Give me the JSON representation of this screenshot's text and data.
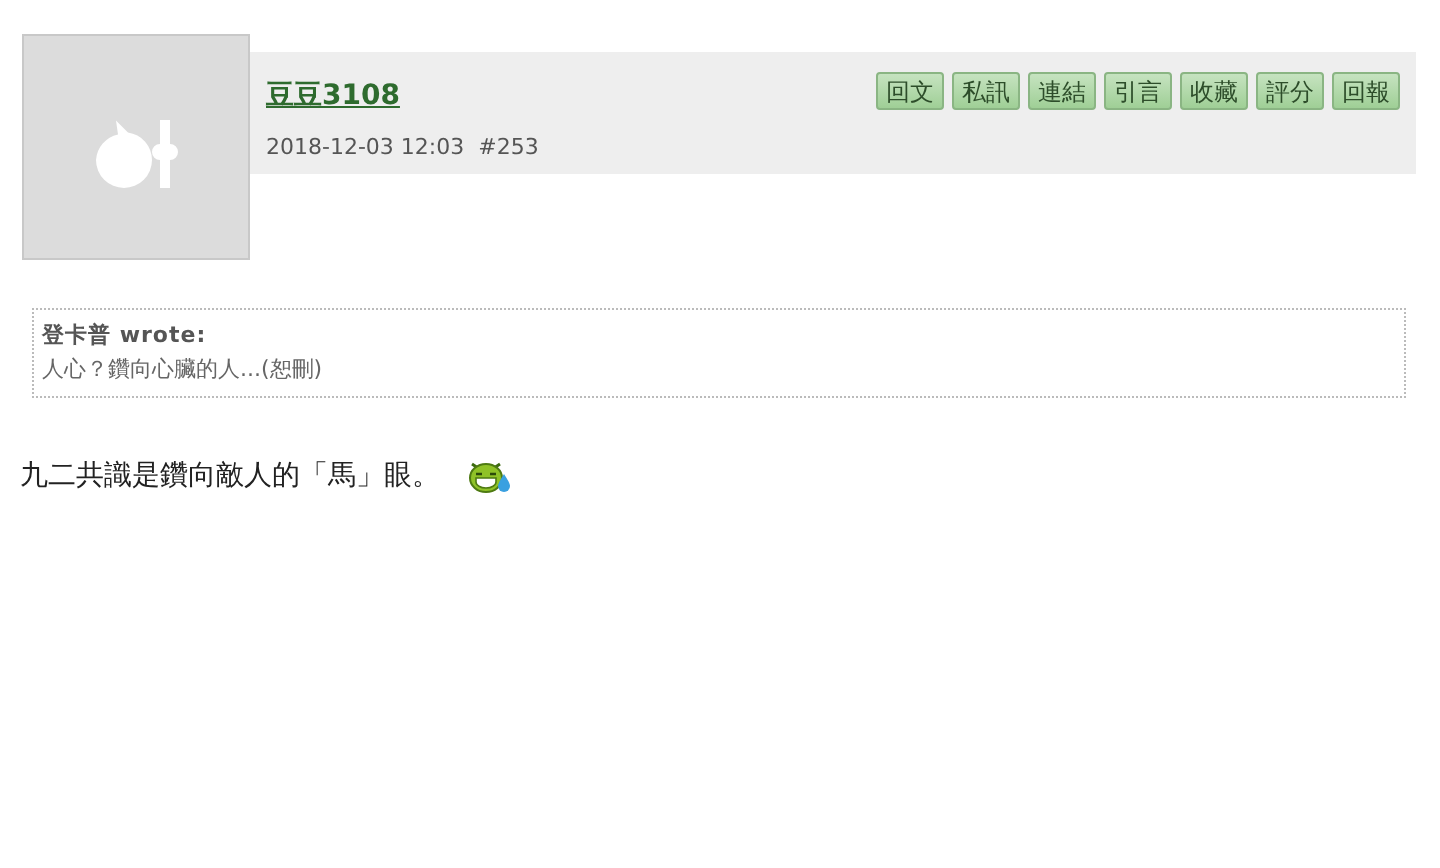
{
  "post": {
    "author": "豆豆3108",
    "meta": "2018-12-03 12:03  #253",
    "buttons": [
      "回文",
      "私訊",
      "連結",
      "引言",
      "收藏",
      "評分",
      "回報"
    ],
    "quote": {
      "author": "登卡普 wrote:",
      "text": "人心？鑽向心臟的人...(恕刪)"
    },
    "body": "九二共識是鑽向敵人的「馬」眼。"
  }
}
